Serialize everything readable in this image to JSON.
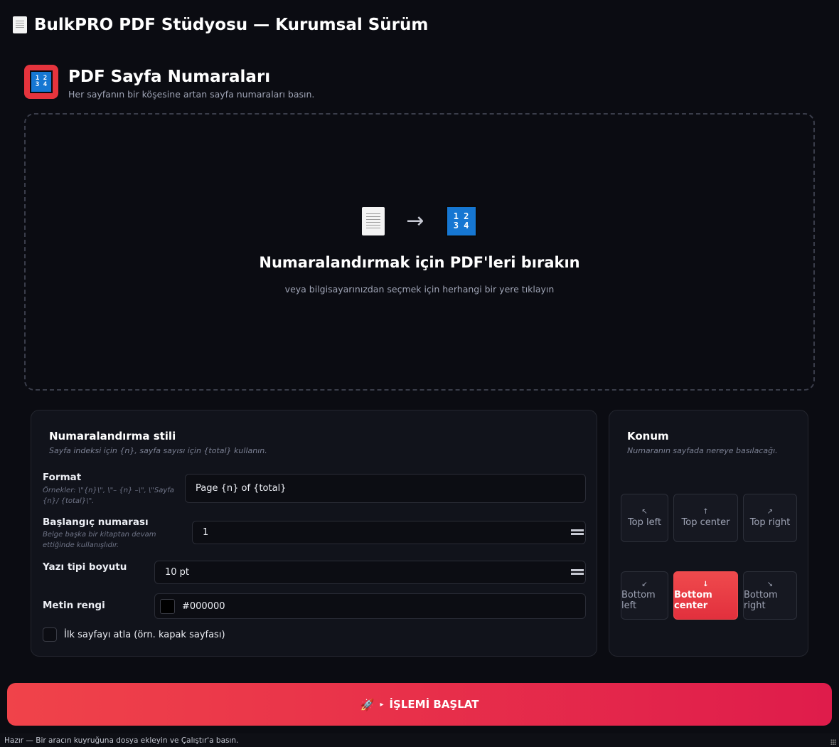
{
  "app": {
    "title": "BulkPRO PDF Stüdyosu — Kurumsal Sürüm",
    "icon": "document-icon"
  },
  "tool": {
    "title": "PDF Sayfa Numaraları",
    "subtitle": "Her sayfanın bir köşesine artan sayfa numaraları basın.",
    "badge_text_top": "1 2",
    "badge_text_bottom": "3 4",
    "badge_color": "#e5343d"
  },
  "dropzone": {
    "arrow": "→",
    "title": "Numaralandırmak için PDF'leri bırakın",
    "subtitle": "veya bilgisayarınızdan seçmek için herhangi bir yere tıklayın"
  },
  "style_panel": {
    "title": "Numaralandırma stili",
    "hint": "Sayfa indeksi için {n}, sayfa sayısı için {total} kullanın.",
    "format": {
      "label": "Format",
      "help": "Örnekler: \\\"{n}\\\", \\\"– {n} –\\\", \\\"Sayfa {n}/ {total}\\\".",
      "value": "Page {n} of {total}"
    },
    "start_number": {
      "label": "Başlangıç numarası",
      "help": "Belge başka bir kitaptan devam ettiğinde kullanışlıdır.",
      "value": "1"
    },
    "font_size": {
      "label": "Yazı tipi boyutu",
      "value": "10 pt"
    },
    "text_color": {
      "label": "Metin rengi",
      "value": "#000000"
    },
    "skip_first": {
      "label": "İlk sayfayı atla (örn. kapak sayfası)",
      "checked": false
    }
  },
  "position_panel": {
    "title": "Konum",
    "hint": "Numaranın sayfada nereye basılacağı.",
    "selected": "Bottom center",
    "buttons": [
      {
        "label": "Top left",
        "arrow": "↖"
      },
      {
        "label": "Top center",
        "arrow": "↑"
      },
      {
        "label": "Top right",
        "arrow": "↗"
      },
      {
        "label": "Bottom left",
        "arrow": "↙"
      },
      {
        "label": "Bottom center",
        "arrow": "↓"
      },
      {
        "label": "Bottom right",
        "arrow": "↘"
      }
    ]
  },
  "run_button": {
    "label": "İŞLEMİ BAŞLAT",
    "icon": "🚀",
    "play": "▸"
  },
  "status": "Hazır — Bir aracın kuyruğuna dosya ekleyin ve Çalıştır'a basın.",
  "colors": {
    "accent": "#e5343d",
    "background": "#0b0c12",
    "panel": "#11131b",
    "tile_blue": "#1677d2"
  }
}
